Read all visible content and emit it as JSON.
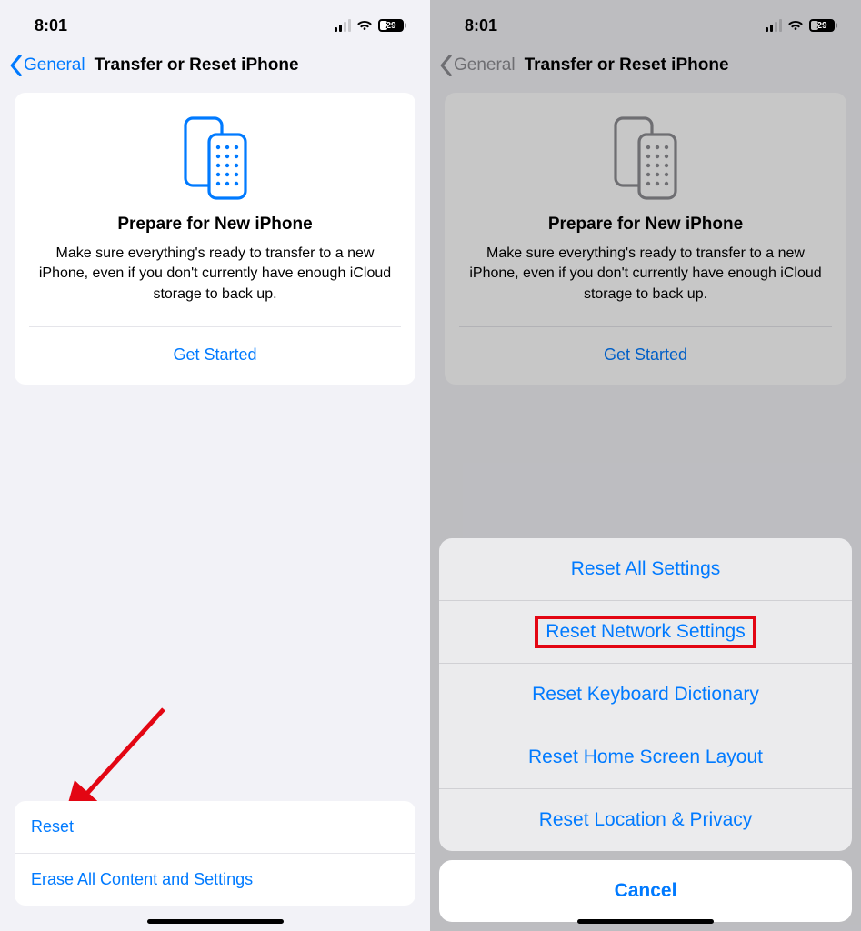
{
  "status": {
    "time": "8:01",
    "battery": "29"
  },
  "nav": {
    "back_label": "General",
    "title": "Transfer or Reset iPhone"
  },
  "card": {
    "title": "Prepare for New iPhone",
    "description": "Make sure everything's ready to transfer to a new iPhone, even if you don't currently have enough iCloud storage to back up.",
    "action": "Get Started"
  },
  "left_bottom": {
    "reset": "Reset",
    "erase": "Erase All Content and Settings"
  },
  "sheet": {
    "options": [
      "Reset All Settings",
      "Reset Network Settings",
      "Reset Keyboard Dictionary",
      "Reset Home Screen Layout",
      "Reset Location & Privacy"
    ],
    "cancel": "Cancel",
    "highlighted_index": 1
  },
  "colors": {
    "accent": "#007aff",
    "highlight": "#e30613"
  }
}
